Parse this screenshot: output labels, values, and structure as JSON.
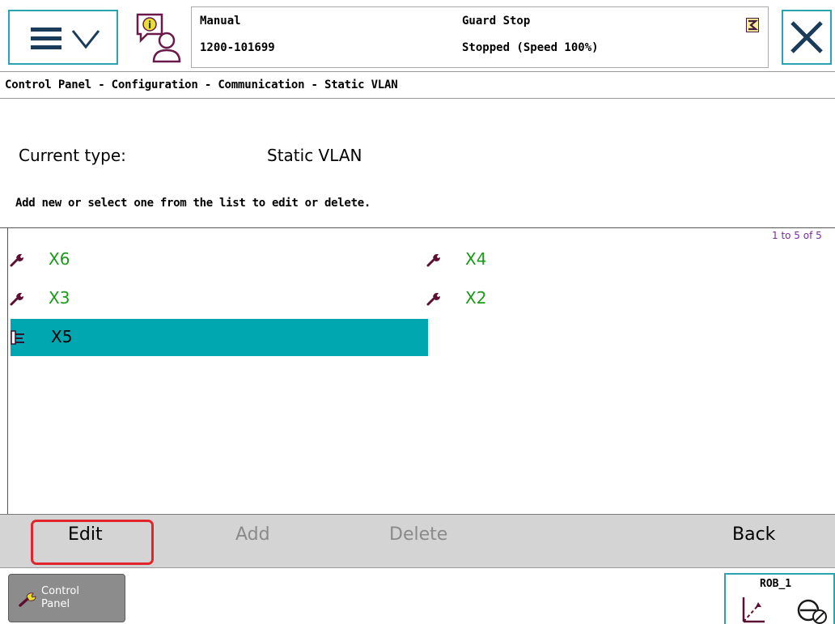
{
  "header": {
    "mode": "Manual",
    "system_id": "1200-101699",
    "safety_state": "Guard Stop",
    "run_state": "Stopped (Speed 100%)"
  },
  "breadcrumb": "Control Panel - Configuration - Communication - Static VLAN",
  "current_type": {
    "label": "Current type:",
    "value": "Static VLAN"
  },
  "instruction": "Add new or select one from the list to edit or delete.",
  "paging": "1 to 5 of 5",
  "list": {
    "items": [
      {
        "label": "X6",
        "icon": "wrench-icon",
        "selected": false
      },
      {
        "label": "X4",
        "icon": "wrench-icon",
        "selected": false
      },
      {
        "label": "X3",
        "icon": "wrench-icon",
        "selected": false
      },
      {
        "label": "X2",
        "icon": "wrench-icon",
        "selected": false
      },
      {
        "label": "X5",
        "icon": "config-item-icon",
        "selected": true
      }
    ]
  },
  "commands": {
    "edit": "Edit",
    "add": "Add",
    "delete": "Delete",
    "back": "Back"
  },
  "taskbar": {
    "control_panel_line1": "Control",
    "control_panel_line2": "Panel",
    "robot": "ROB_1"
  },
  "colors": {
    "accent": "#2aa3b0",
    "selection": "#00a6b0",
    "item_text": "#1a9a1a",
    "highlight": "#e0262c"
  }
}
